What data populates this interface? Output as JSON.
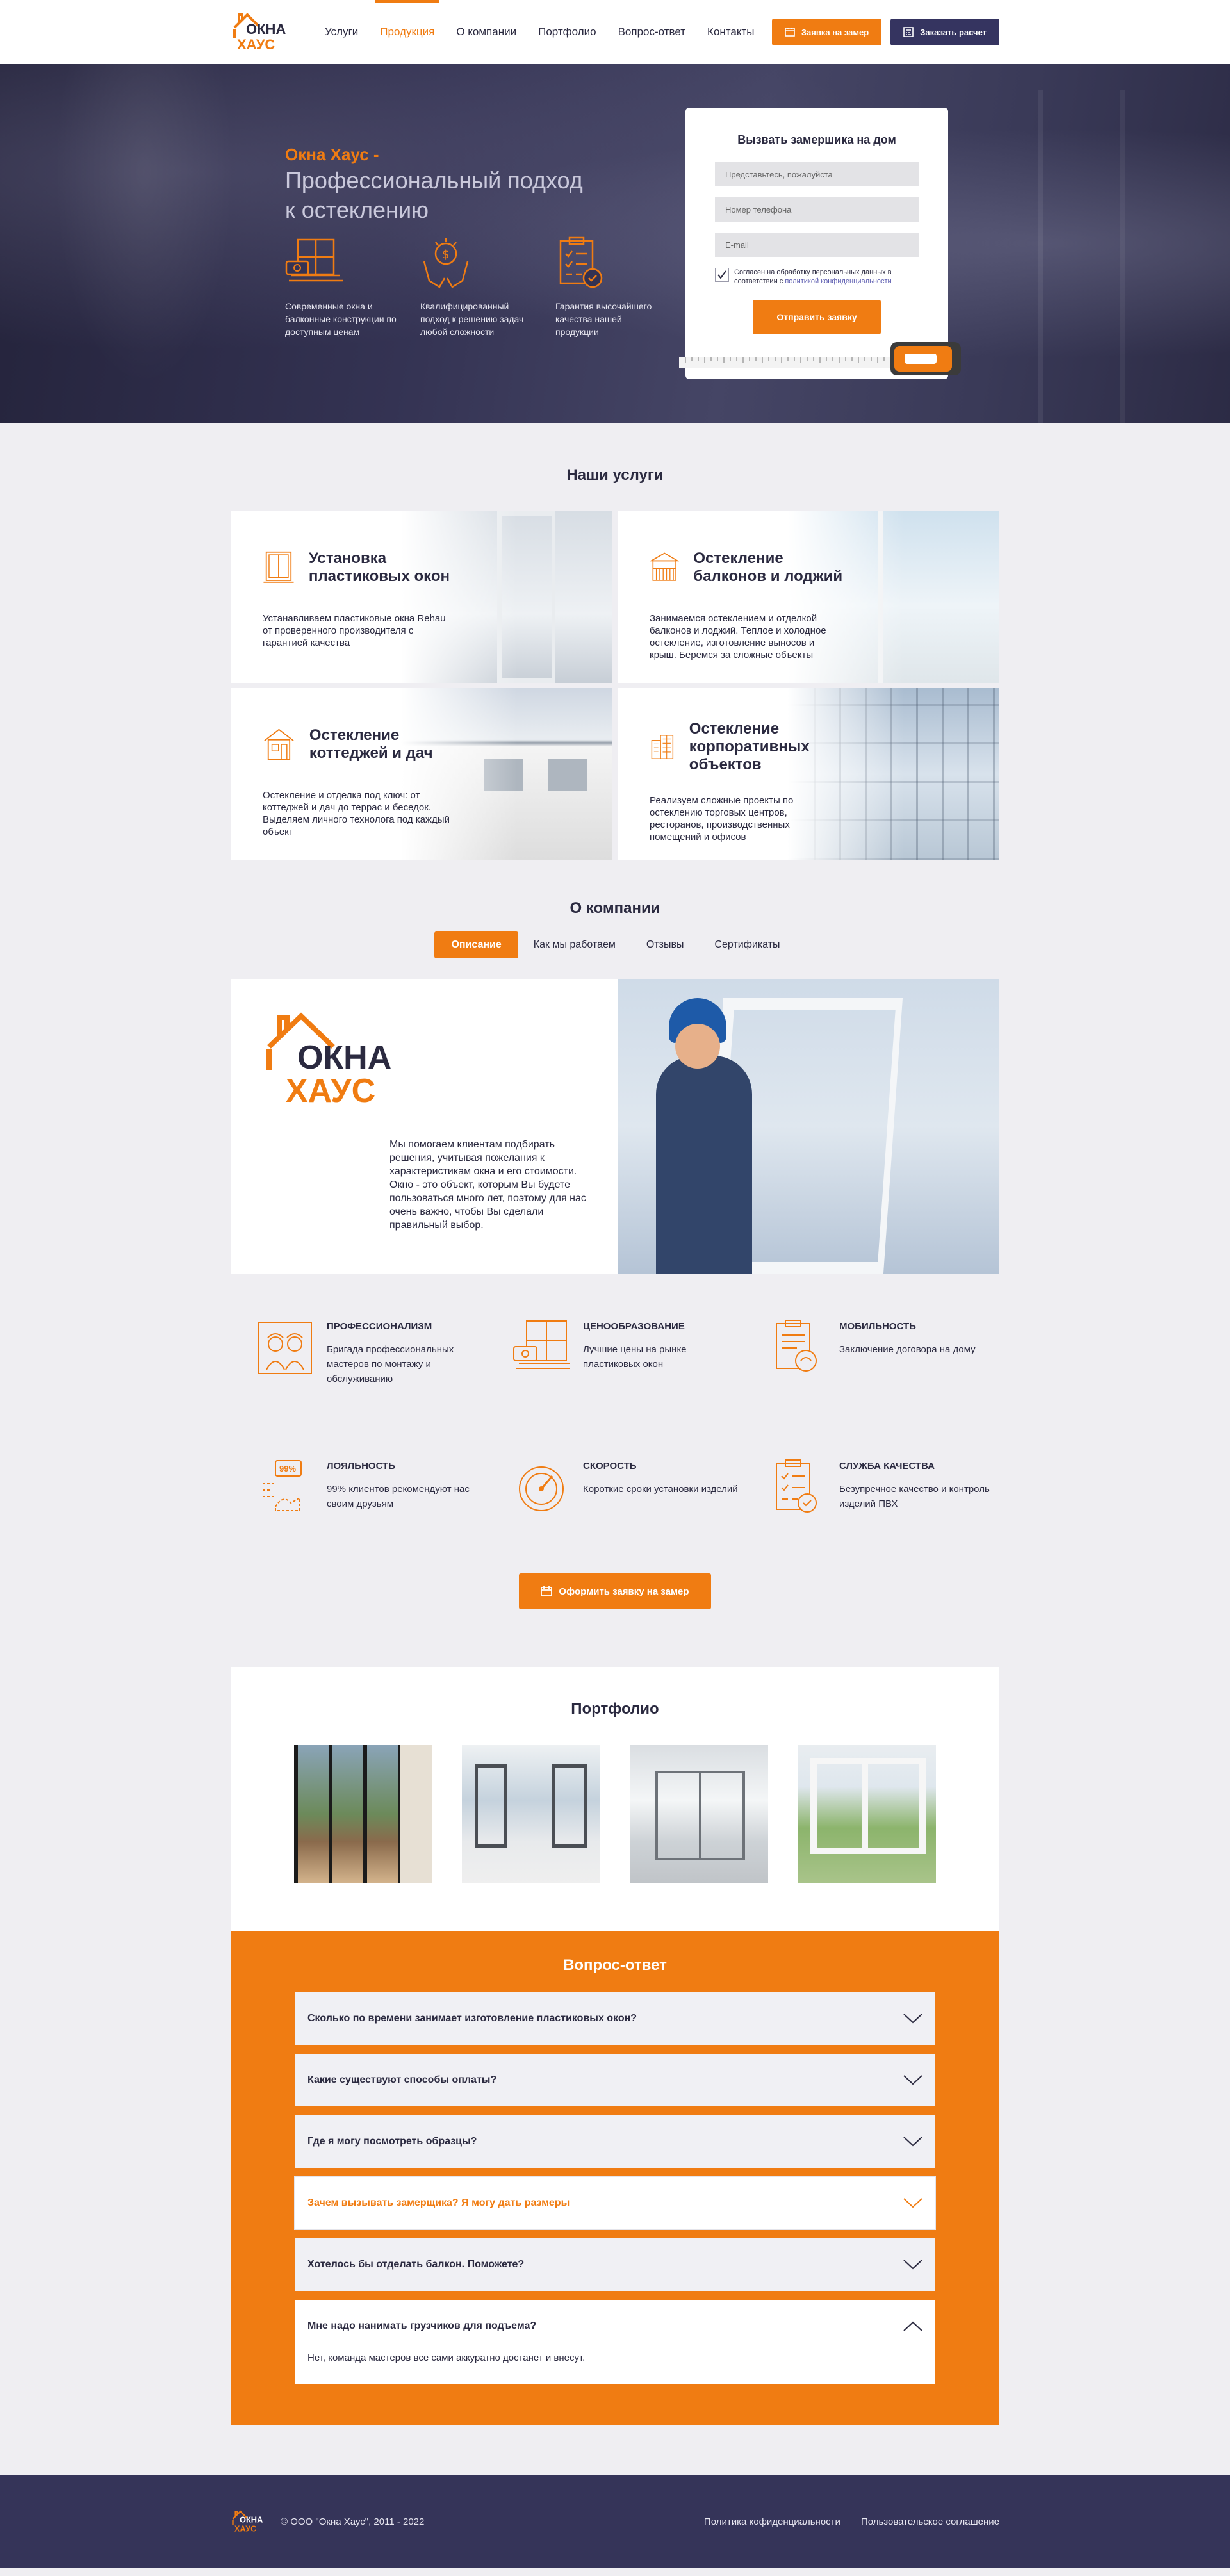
{
  "brand": {
    "logo_line1": "ОКНА",
    "logo_line2": "ХАУС"
  },
  "nav": {
    "items": [
      "Услуги",
      "Продукция",
      "О компании",
      "Портфолио",
      "Вопрос-ответ",
      "Контакты"
    ],
    "active_index": 1
  },
  "header": {
    "btn_measure": "Заявка на замер",
    "btn_calc": "Заказать расчет"
  },
  "hero": {
    "brand": "Окна Хаус -",
    "subtitle_line1": "Профессиональный подход",
    "subtitle_line2": "к остеклению",
    "features": [
      {
        "icon": "window-icon",
        "text": "Современные окна и балконные конструкции по доступным ценам"
      },
      {
        "icon": "money-hands-icon",
        "text": "Квалифицированный подход к решению задач любой сложности"
      },
      {
        "icon": "checklist-icon",
        "text": "Гарантия высочайшего качества нашей продукции"
      }
    ]
  },
  "form": {
    "title": "Вызвать замершика на дом",
    "name_placeholder": "Представьтесь, пожалуйста",
    "phone_placeholder": "Номер телефона",
    "email_placeholder": "E-mail",
    "agree_text": "Согласен на обработку персональных данных в соответствии с",
    "agree_link": "политикой конфиденциальности",
    "agree_checked": true,
    "submit": "Отправить заявку"
  },
  "services": {
    "title": "Наши услуги",
    "items": [
      {
        "title": "Установка пластиковых окон",
        "text": "Устанавливаем пластиковые окна Rehau от проверенного производителя с гарантией качества",
        "icon": "plastic-window-icon"
      },
      {
        "title": "Остекление балконов и лоджий",
        "text": "Занимаемся остеклением и отделкой балконов и лоджий. Теплое и холодное остекление, изготовление выносов и крыш. Беремся за сложные объекты",
        "icon": "balcony-icon"
      },
      {
        "title": "Остекление коттеджей и дач",
        "text": "Остекление и отделка под ключ: от коттеджей и дач до террас и беседок. Выделяем личного технолога под каждый объект",
        "icon": "cottage-icon"
      },
      {
        "title": "Остекление корпоративных объектов",
        "text": "Реализуем сложные проекты по остеклению торговых центров, ресторанов, производственных помещений и офисов",
        "icon": "office-building-icon"
      }
    ]
  },
  "about": {
    "title": "О компании",
    "tabs": [
      "Описание",
      "Как мы работаем",
      "Отзывы",
      "Сертификаты"
    ],
    "active_tab": 0,
    "text": "Мы помогаем клиентам подбирать решения, учитывая пожелания к характеристикам окна и его стоимости. Окно - это объект, которым Вы будете пользоваться много лет, поэтому для нас очень важно, чтобы Вы сделали правильный выбор.",
    "features": [
      {
        "title": "ПРОФЕССИОНАЛИЗМ",
        "text": "Бригада профессиональных мастеров по монтажу и обслуживанию",
        "icon": "workers-icon"
      },
      {
        "title": "ЦЕНООБРАЗОВАНИЕ",
        "text": "Лучшие цены на рынке пластиковых окон",
        "icon": "price-window-icon"
      },
      {
        "title": "МОБИЛЬНОСТЬ",
        "text": "Заключение договора на дому",
        "icon": "contract-icon"
      },
      {
        "title": "ЛОЯЛЬНОСТЬ",
        "text": "99% клиентов рекомендуют нас своим друзьям",
        "icon": "loyalty-icon",
        "badge": "99%"
      },
      {
        "title": "СКОРОСТЬ",
        "text": "Короткие сроки установки изделий",
        "icon": "speedometer-icon"
      },
      {
        "title": "СЛУЖБА КАЧЕСТВА",
        "text": "Безупречное качество и контроль изделий ПВХ",
        "icon": "quality-checklist-icon"
      }
    ],
    "cta": "Оформить заявку на замер"
  },
  "portfolio": {
    "title": "Портфолио",
    "items": [
      {
        "alt": "portfolio-photo-1"
      },
      {
        "alt": "portfolio-photo-2"
      },
      {
        "alt": "portfolio-photo-3"
      },
      {
        "alt": "portfolio-photo-4"
      }
    ]
  },
  "faq": {
    "title": "Вопрос-ответ",
    "items": [
      {
        "q": "Сколько по времени занимает изготовление пластиковых окон?",
        "state": "closed"
      },
      {
        "q": "Какие существуют способы оплаты?",
        "state": "closed"
      },
      {
        "q": "Где я могу посмотреть образцы?",
        "state": "closed"
      },
      {
        "q": "Зачем вызывать замерщика? Я могу дать размеры",
        "state": "hover"
      },
      {
        "q": "Хотелось бы отделать балкон. Поможете?",
        "state": "closed"
      },
      {
        "q": "Мне надо нанимать грузчиков для подъема?",
        "state": "open",
        "a": "Нет, команда мастеров все сами аккуратно достанет и внесут."
      }
    ]
  },
  "footer": {
    "copyright": "© ООО \"Окна Хаус\", 2011 - 2022",
    "privacy": "Политика кофиденциальности",
    "terms": "Пользовательское соглашение"
  },
  "colors": {
    "accent": "#f07c12",
    "dark": "#353460",
    "text": "#2b2a40"
  }
}
